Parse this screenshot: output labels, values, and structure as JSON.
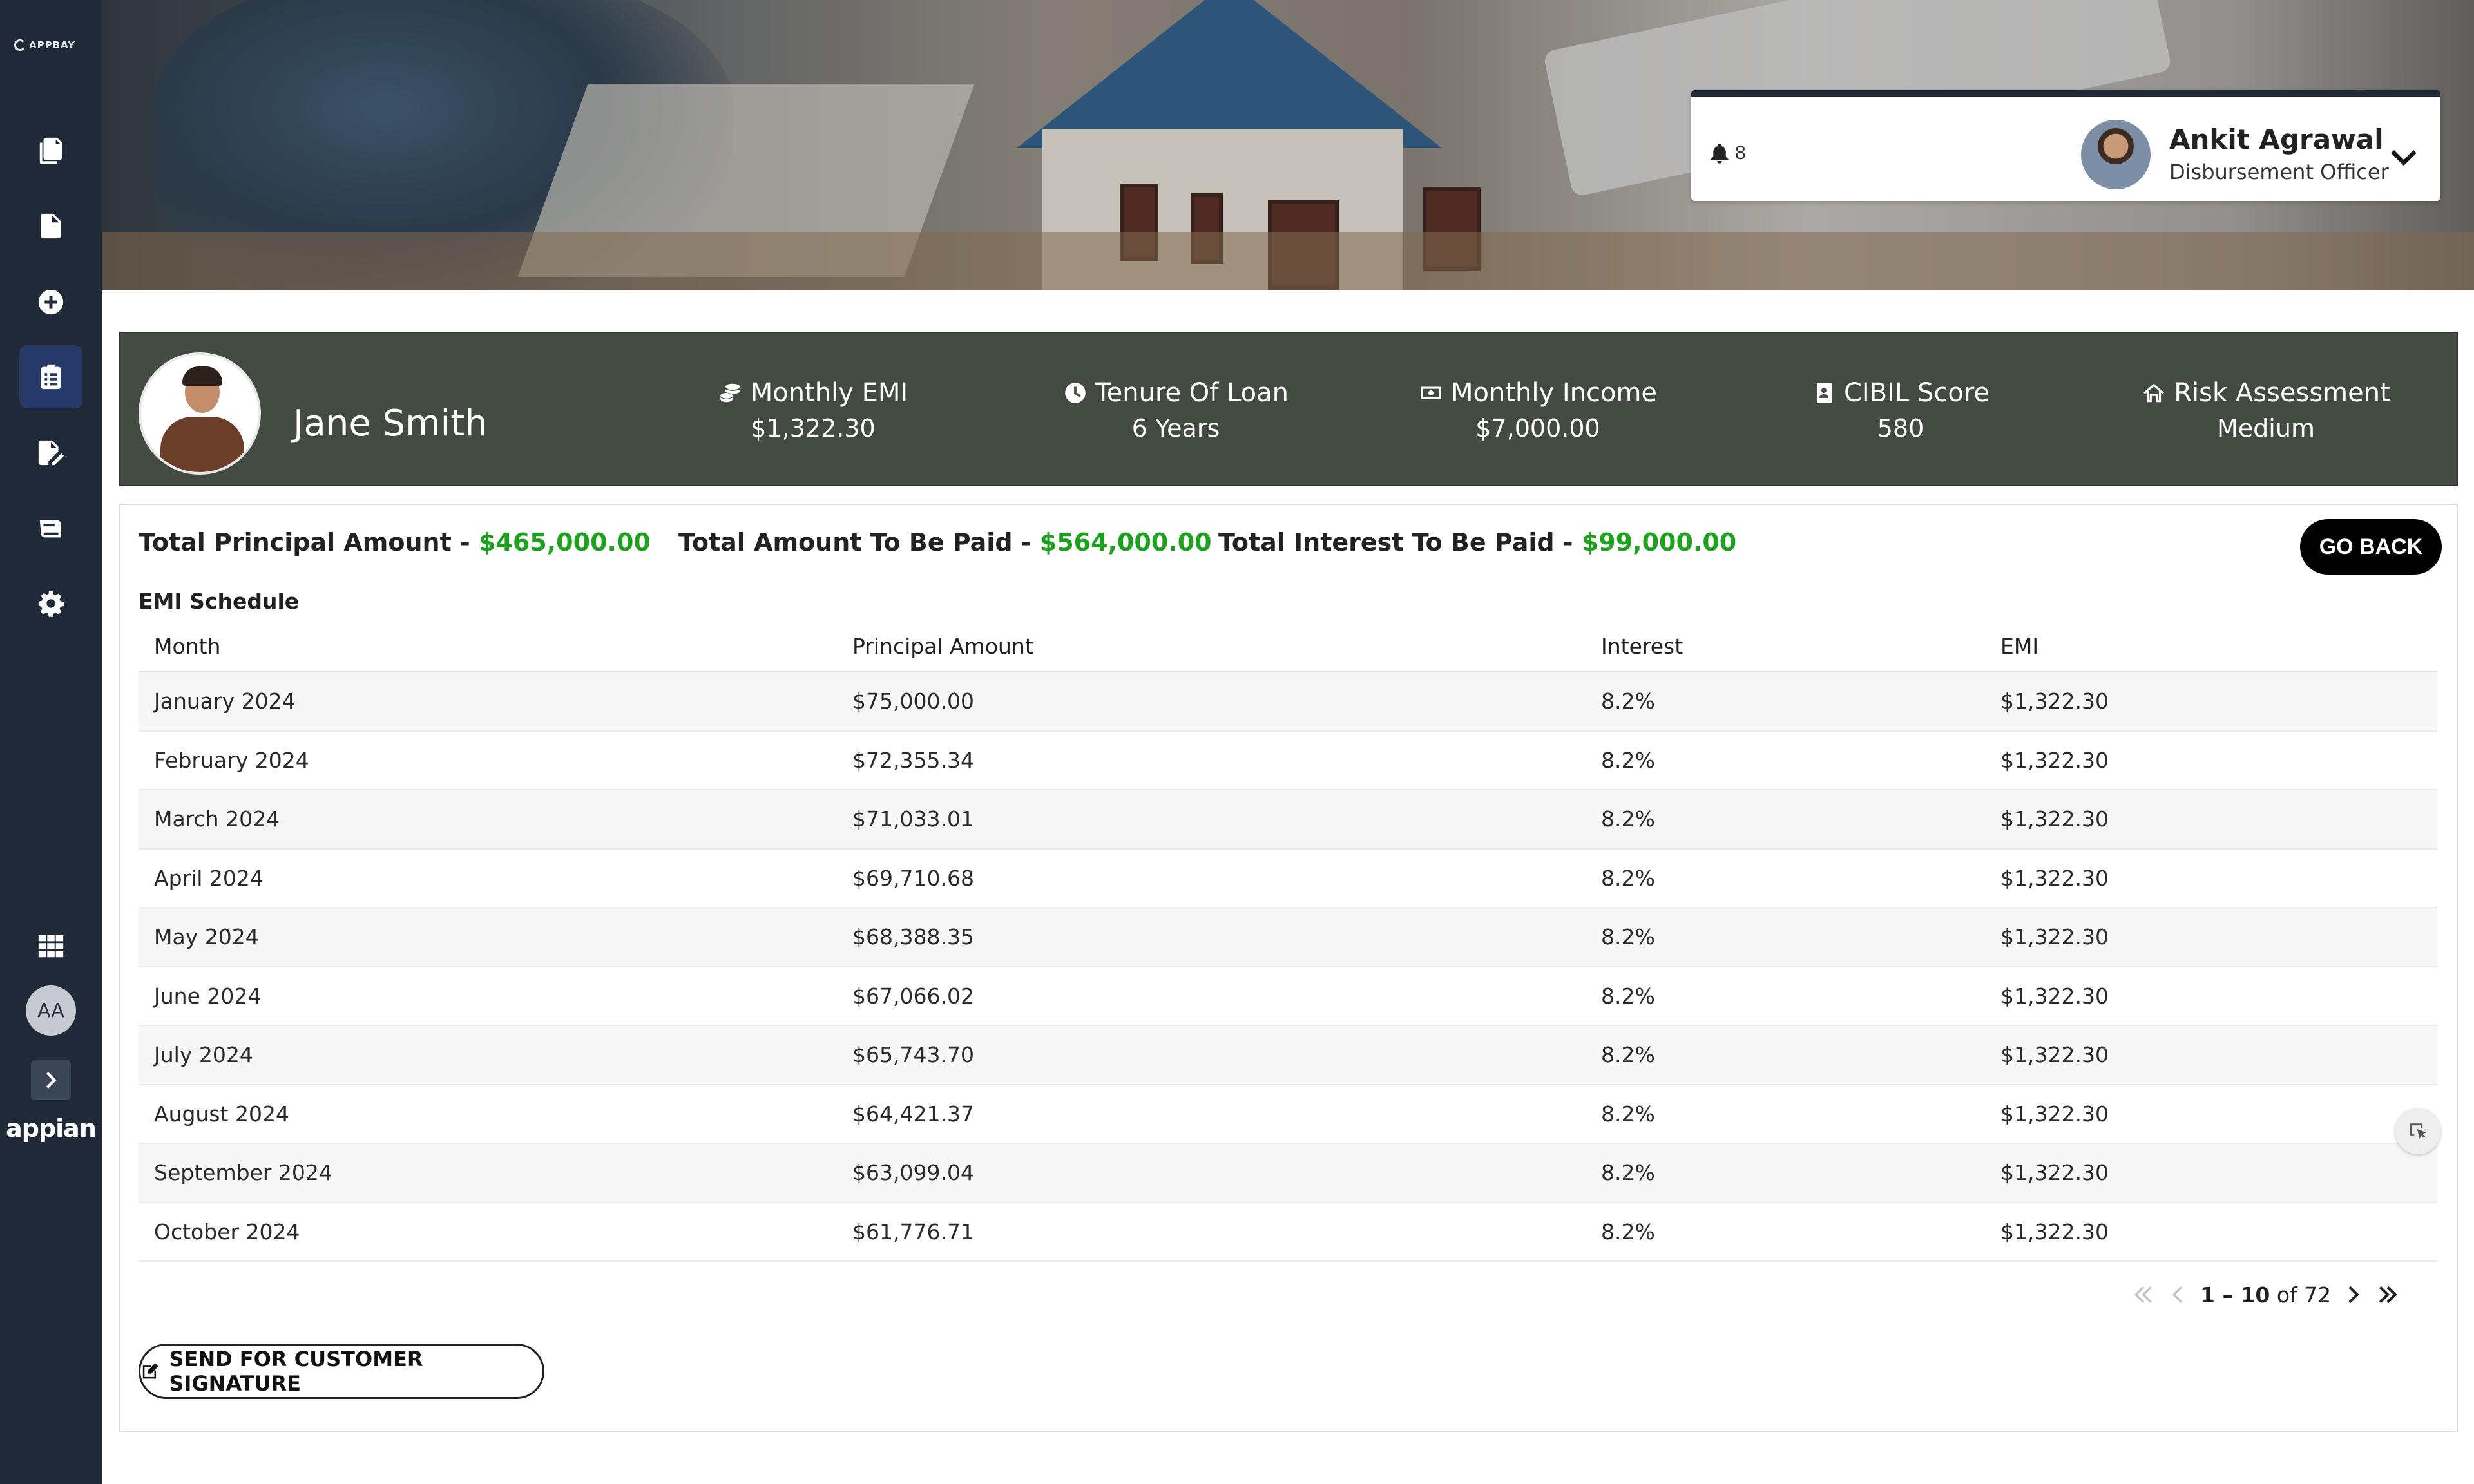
{
  "sidebar": {
    "logo_text": "APPBAY",
    "avatar_initials": "AA",
    "brand": "appian"
  },
  "header": {
    "notification_count": "8",
    "user_name": "Ankit Agrawal",
    "user_role": "Disbursement Officer"
  },
  "profile": {
    "name": "Jane Smith",
    "metrics": [
      {
        "label": "Monthly EMI",
        "value": "$1,322.30"
      },
      {
        "label": "Tenure Of Loan",
        "value": "6 Years"
      },
      {
        "label": "Monthly Income",
        "value": "$7,000.00"
      },
      {
        "label": "CIBIL Score",
        "value": "580"
      },
      {
        "label": "Risk Assessment",
        "value": "Medium"
      }
    ]
  },
  "totals": {
    "principal_label": "Total Principal Amount - ",
    "principal_value": "$465,000.00",
    "amount_label": "Total Amount To Be Paid - ",
    "amount_value": "$564,000.00",
    "interest_label": "Total Interest To Be Paid - ",
    "interest_value": "$99,000.00"
  },
  "go_back_label": "GO BACK",
  "schedule": {
    "title": "EMI Schedule",
    "columns": [
      "Month",
      "Principal Amount",
      "Interest",
      "EMI"
    ],
    "rows": [
      [
        "January 2024",
        "$75,000.00",
        "8.2%",
        "$1,322.30"
      ],
      [
        "February 2024",
        "$72,355.34",
        "8.2%",
        "$1,322.30"
      ],
      [
        "March 2024",
        "$71,033.01",
        "8.2%",
        "$1,322.30"
      ],
      [
        "April 2024",
        "$69,710.68",
        "8.2%",
        "$1,322.30"
      ],
      [
        "May 2024",
        "$68,388.35",
        "8.2%",
        "$1,322.30"
      ],
      [
        "June 2024",
        "$67,066.02",
        "8.2%",
        "$1,322.30"
      ],
      [
        "July 2024",
        "$65,743.70",
        "8.2%",
        "$1,322.30"
      ],
      [
        "August 2024",
        "$64,421.37",
        "8.2%",
        "$1,322.30"
      ],
      [
        "September 2024",
        "$63,099.04",
        "8.2%",
        "$1,322.30"
      ],
      [
        "October 2024",
        "$61,776.71",
        "8.2%",
        "$1,322.30"
      ]
    ]
  },
  "pager": {
    "range": "1 – 10",
    "of_text": " of 72"
  },
  "send_signature_label": "SEND FOR CUSTOMER SIGNATURE",
  "colors": {
    "sidebar_bg": "#1f2937",
    "active_nav": "#263a6a",
    "profile_strip": "#434a41",
    "amount_green": "#1ea21e"
  },
  "icons": [
    "documents-icon",
    "file-icon",
    "plus-circle-icon",
    "clipboard-icon",
    "edit-document-icon",
    "book-icon",
    "gear-icon",
    "grid-icon",
    "chevron-right-icon",
    "bell-icon",
    "chevron-down-icon",
    "coins-icon",
    "clock-icon",
    "money-bill-icon",
    "address-book-icon",
    "house-icon",
    "edit-icon",
    "first-page-icon",
    "prev-page-icon",
    "next-page-icon",
    "last-page-icon",
    "cursor-select-icon"
  ]
}
